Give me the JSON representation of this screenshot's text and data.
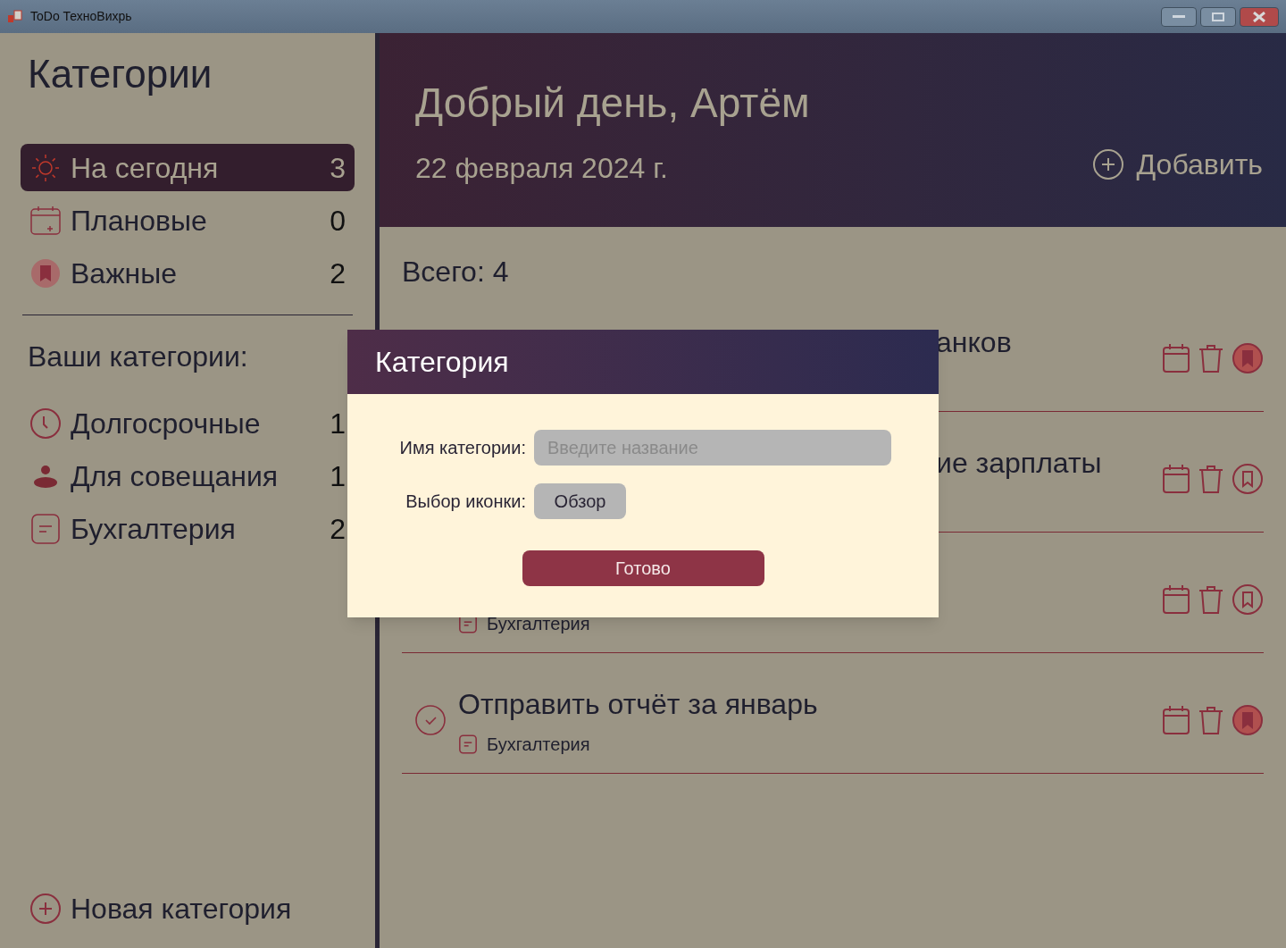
{
  "window": {
    "title": "ToDo ТехноВихрь"
  },
  "sidebar": {
    "title": "Категории",
    "items": [
      {
        "kind": "sun",
        "label": "На сегодня",
        "count": "3",
        "selected": true
      },
      {
        "kind": "calendar",
        "label": "Плановые",
        "count": "0",
        "selected": false
      },
      {
        "kind": "bookmark",
        "label": "Важные",
        "count": "2",
        "selected": false
      }
    ],
    "section_title": "Ваши категории:",
    "categories": [
      {
        "kind": "clock",
        "label": "Долгосрочные",
        "count": "1"
      },
      {
        "kind": "people",
        "label": "Для совещания",
        "count": "1"
      },
      {
        "kind": "note",
        "label": "Бухгалтерия",
        "count": "2"
      }
    ],
    "new_category": "Новая категория"
  },
  "header": {
    "greeting": "Добрый день, Артём",
    "date": "22 февраля 2024 г.",
    "add_button": "Добавить"
  },
  "total": "Всего: 4",
  "tasks": [
    {
      "kind": "covered",
      "title": "анков",
      "important": true
    },
    {
      "kind": "covered",
      "title": "ие зарплаты",
      "important": false
    },
    {
      "kind": "covered",
      "category": "Бухгалтерия",
      "important": false
    },
    {
      "kind": "full",
      "title": "Отправить отчёт за январь",
      "category": "Бухгалтерия",
      "important": true
    }
  ],
  "dialog": {
    "title": "Категория",
    "name_label": "Имя категории:",
    "name_placeholder": "Введите название",
    "icon_label": "Выбор иконки:",
    "browse_button": "Обзор",
    "done_button": "Готово"
  }
}
